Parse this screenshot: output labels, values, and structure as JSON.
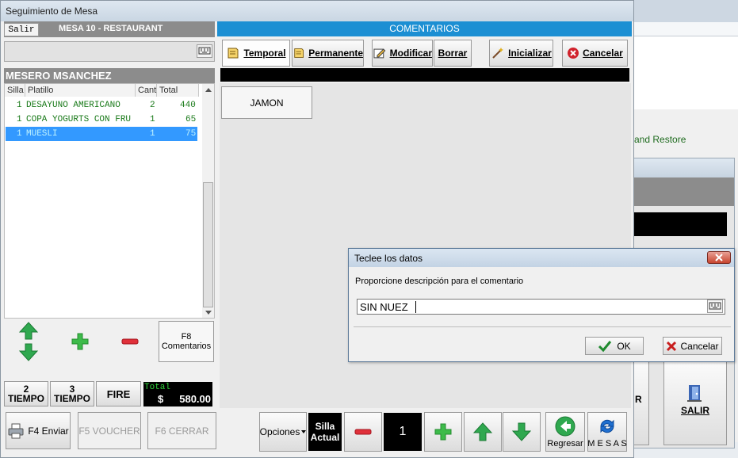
{
  "window": {
    "title": "Seguimiento de Mesa",
    "salir_label": "Salir",
    "mesa_title": "MESA 10 - RESTAURANT"
  },
  "waiter": {
    "label": "MESERO MSANCHEZ"
  },
  "order_table": {
    "headers": [
      "Silla",
      "Platillo",
      "Cant",
      "Total"
    ],
    "rows": [
      {
        "silla": "1",
        "platillo": "DESAYUNO AMERICANO",
        "cant": "2",
        "total": "440"
      },
      {
        "silla": "1",
        "platillo": "COPA YOGURTS CON FRU",
        "cant": "1",
        "total": "65"
      },
      {
        "silla": "1",
        "platillo": "MUESLI",
        "cant": "1",
        "total": "75",
        "selected": true
      }
    ]
  },
  "left_controls": {
    "f8_line1": "F8",
    "f8_line2": "Comentarios"
  },
  "tiempos": {
    "t2_num": "2",
    "t2_label": "TIEMPO",
    "t3_num": "3",
    "t3_label": "TIEMPO",
    "fire": "FIRE"
  },
  "total": {
    "caption": "Total",
    "currency": "$",
    "amount": "580.00"
  },
  "bottom_left": {
    "f4": "F4 Enviar",
    "f5": "F5 VOUCHER",
    "f6": "F6 CERRAR"
  },
  "comments": {
    "header": "COMENTARIOS",
    "toolbar": {
      "temporal": "Temporal",
      "permanente": "Permanente",
      "modificar": "Modificar",
      "borrar": "Borrar",
      "inicializar": "Inicializar",
      "cancelar": "Cancelar"
    },
    "items": [
      "JAMON"
    ]
  },
  "bottom_bar": {
    "opciones": "Opciones",
    "silla_line1": "Silla",
    "silla_line2": "Actual",
    "seat_number": "1",
    "regresar": "Regresar",
    "mesas": "M E S A S"
  },
  "background": {
    "restore_text": "and Restore",
    "partial_letter": "R",
    "salir": "SALIR"
  },
  "dialog": {
    "title": "Teclee los datos",
    "prompt": "Proporcione descripción para el comentario",
    "input_value": "SIN NUEZ",
    "ok": "OK",
    "cancel": "Cancelar"
  },
  "colors": {
    "accent_blue": "#1c8fd3",
    "header_gray": "#8c8c8c",
    "selected_row": "#3399ff",
    "green_text": "#1a7a1a",
    "cancel_red": "#d0222c",
    "arrow_green": "#2fa84f"
  }
}
